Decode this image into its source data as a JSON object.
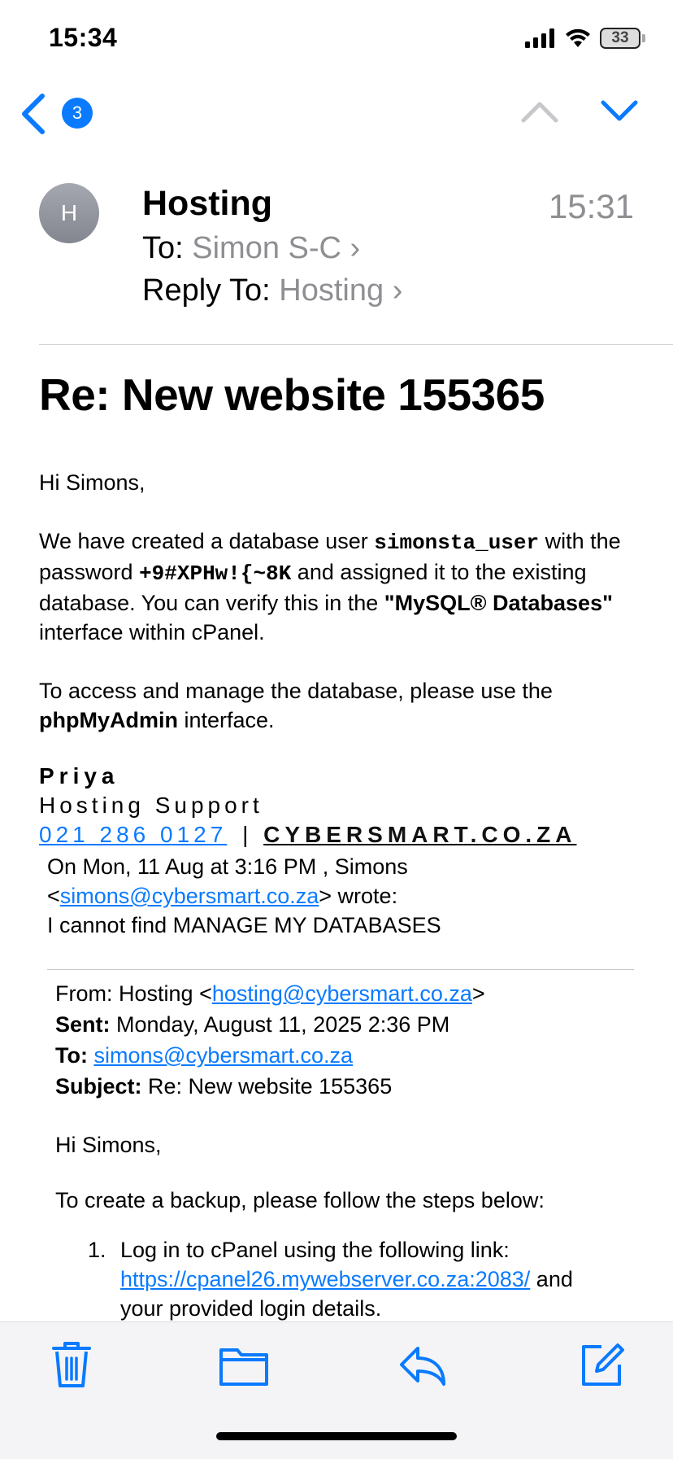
{
  "status": {
    "time": "15:34",
    "battery": "33"
  },
  "nav": {
    "badge_count": "3"
  },
  "header": {
    "avatar_initial": "H",
    "sender": "Hosting",
    "time": "15:31",
    "to_label": "To:",
    "to_value": "Simon S-C",
    "reply_label": "Reply To:",
    "reply_value": "Hosting"
  },
  "subject": "Re: New website 155365",
  "body": {
    "greeting": "Hi Simons,",
    "p1_a": "We have created a database user ",
    "db_user": "simonsta_user",
    "p1_b": " with the password ",
    "password": "+9#XPHw!{~8K",
    "p1_c": " and assigned it to the existing database. You can verify this in the ",
    "mysql_label": "\"MySQL® Databases\"",
    "p1_d": " interface within cPanel.",
    "p2_a": "To access and manage the database, please use the ",
    "phpmyadmin": "phpMyAdmin",
    "p2_b": " interface."
  },
  "signature": {
    "name": "Priya",
    "role": "Hosting Support",
    "phone": "021 286 0127",
    "separator": "|",
    "site": "CYBERSMART.CO.ZA"
  },
  "quote_intro": {
    "line1": "On Mon, 11 Aug at 3:16 PM , Simons",
    "lt": "<",
    "email": "simons@cybersmart.co.za",
    "gt_wrote": "> wrote:",
    "line3": "I cannot find MANAGE MY DATABASES"
  },
  "quoted": {
    "from_label": "From:",
    "from_name": "Hosting <",
    "from_email": "hosting@cybersmart.co.za",
    "from_end": ">",
    "sent_label": "Sent:",
    "sent_value": "Monday, August 11, 2025 2:36 PM",
    "to_label": "To:",
    "to_email": "simons@cybersmart.co.za",
    "subject_label": "Subject:",
    "subject_value": "Re: New website 155365",
    "greeting": "Hi Simons,",
    "intro": "To create a backup, please follow the steps below:",
    "step1_num": "1.",
    "step1_a": "Log in to cPanel using the following link: ",
    "step1_link": "https://cpanel26.mywebserver.co.za:2083/",
    "step1_b": " and your provided login details."
  },
  "icons": {
    "back": "chevron-left-icon",
    "up": "chevron-up-icon",
    "down": "chevron-down-icon",
    "trash": "trash-icon",
    "folder": "folder-icon",
    "reply": "reply-icon",
    "compose": "compose-icon"
  },
  "colors": {
    "accent": "#0a7aff",
    "secondary_text": "#8e8e93",
    "toolbar_bg": "#f4f4f6"
  }
}
